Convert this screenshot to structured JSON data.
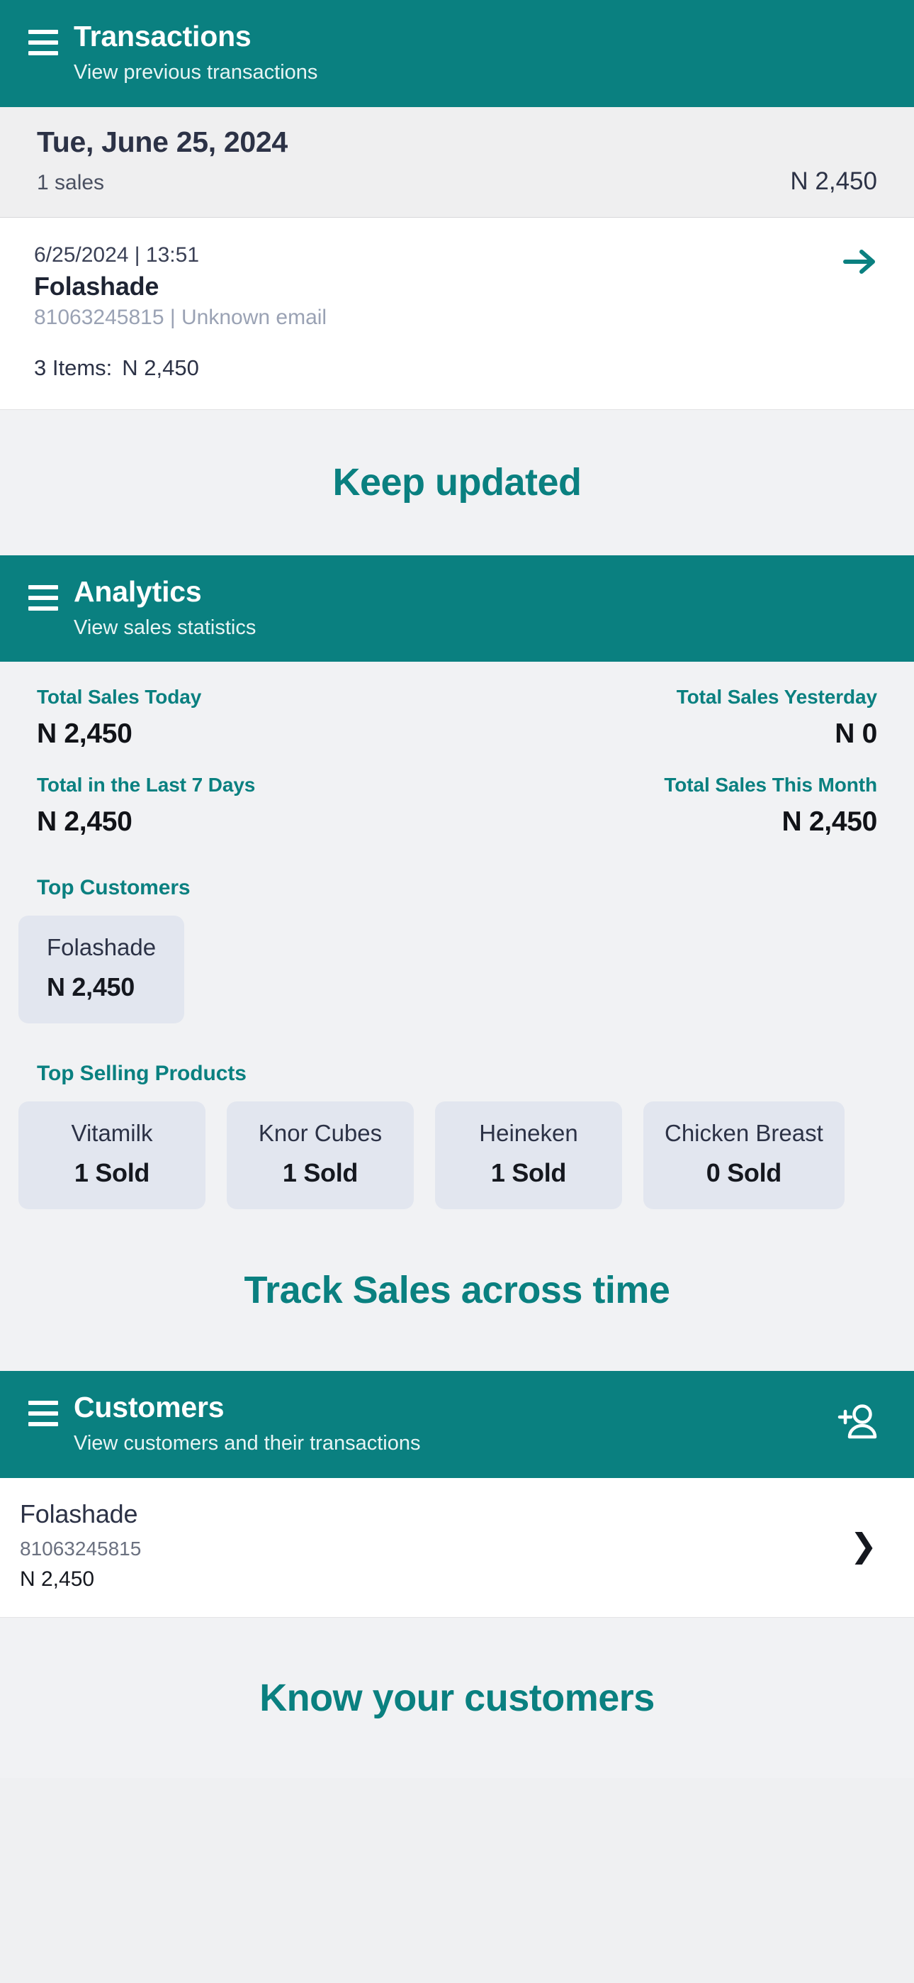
{
  "transactions": {
    "header": {
      "title": "Transactions",
      "subtitle": "View previous transactions",
      "menu_icon": "hamburger-menu-icon"
    },
    "date_group": {
      "date": "Tue, June 25, 2024",
      "count": "1 sales",
      "total": "N 2,450"
    },
    "item": {
      "timestamp": "6/25/2024 | 13:51",
      "customer": "Folashade",
      "contact": "81063245815 | Unknown email",
      "items_label": "3 Items:",
      "items_amount": "N 2,450",
      "arrow_icon": "arrow-right-icon"
    },
    "promo": "Keep updated"
  },
  "analytics": {
    "header": {
      "title": "Analytics",
      "subtitle": "View sales statistics",
      "menu_icon": "hamburger-menu-icon"
    },
    "stats": [
      {
        "label": "Total Sales Today",
        "value": "N 2,450"
      },
      {
        "label": "Total Sales Yesterday",
        "value": "N 0"
      },
      {
        "label": "Total in the Last 7 Days",
        "value": "N 2,450"
      },
      {
        "label": "Total Sales This Month",
        "value": "N 2,450"
      }
    ],
    "top_customers_heading": "Top Customers",
    "top_customers": [
      {
        "name": "Folashade",
        "value": "N 2,450"
      }
    ],
    "top_products_heading": "Top Selling Products",
    "top_products": [
      {
        "name": "Vitamilk",
        "value": "1 Sold"
      },
      {
        "name": "Knor Cubes",
        "value": "1 Sold"
      },
      {
        "name": "Heineken",
        "value": "1 Sold"
      },
      {
        "name": "Chicken Breast",
        "value": "0 Sold"
      }
    ],
    "promo": "Track Sales across time"
  },
  "customers": {
    "header": {
      "title": "Customers",
      "subtitle": "View customers and their transactions",
      "menu_icon": "hamburger-menu-icon",
      "action_icon": "add-user-icon"
    },
    "rows": [
      {
        "name": "Folashade",
        "phone": "81063245815",
        "amount": "N 2,450",
        "chevron": "❯"
      }
    ],
    "promo": "Know your customers"
  },
  "theme": {
    "teal": "#0A8080",
    "page_bg": "#F1F2F4",
    "card_bg": "#E2E6EF",
    "text_dark": "#2C3246"
  }
}
